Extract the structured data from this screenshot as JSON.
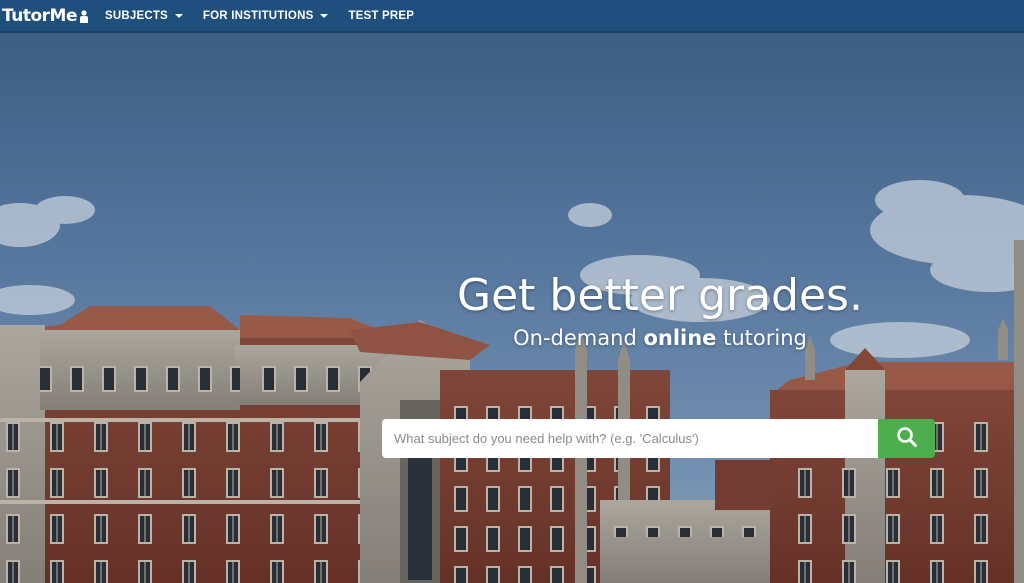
{
  "navbar": {
    "logo_text": "TutorMe",
    "items": [
      {
        "label": "SUBJECTS",
        "has_dropdown": true
      },
      {
        "label": "FOR INSTITUTIONS",
        "has_dropdown": true
      },
      {
        "label": "TEST PREP",
        "has_dropdown": false
      }
    ]
  },
  "hero": {
    "headline": "Get better grades.",
    "sub_pre": "On-demand ",
    "sub_bold": "online",
    "sub_post": " tutoring"
  },
  "search": {
    "placeholder": "What subject do you need help with? (e.g. 'Calculus')",
    "value": "",
    "button_icon": "search-icon"
  },
  "colors": {
    "navbar": "#1f4f7d",
    "search_button": "#4cae4c"
  }
}
